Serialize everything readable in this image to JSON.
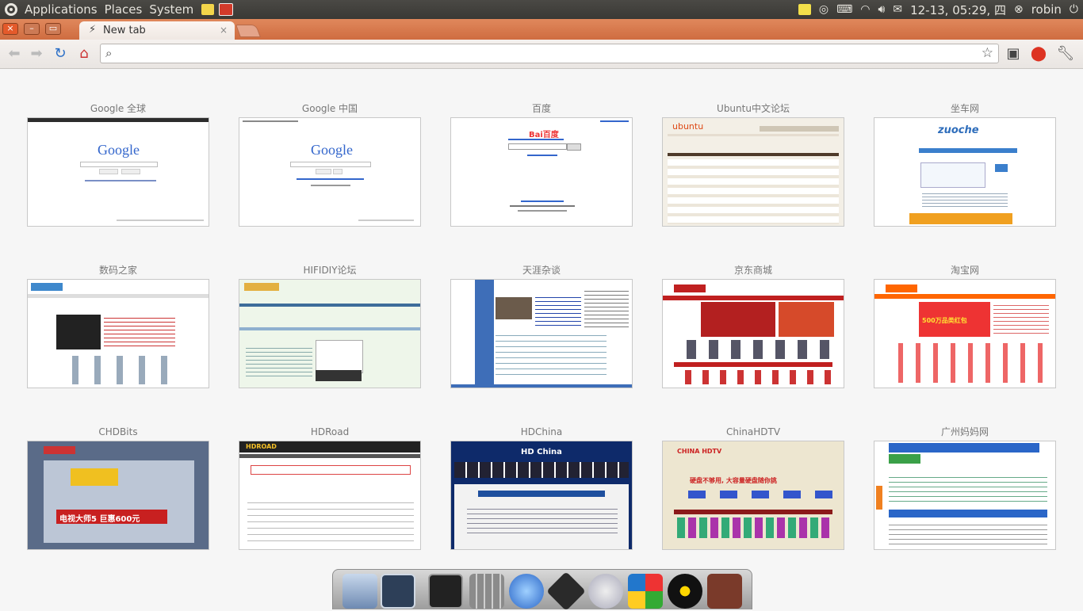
{
  "panel": {
    "menus": [
      "Applications",
      "Places",
      "System"
    ],
    "datetime": "12-13, 05:29, 四",
    "user": "robin"
  },
  "tab": {
    "title": "New tab",
    "close": "×"
  },
  "toolbar": {
    "url": "",
    "placeholder": ""
  },
  "tiles": [
    {
      "title": "Google 全球",
      "thumb_logo": "Google"
    },
    {
      "title": "Google 中国",
      "thumb_logo": "Google"
    },
    {
      "title": "百度",
      "thumb_logo": "Bai百度"
    },
    {
      "title": "Ubuntu中文论坛",
      "thumb_logo": "ubuntu"
    },
    {
      "title": "坐车网",
      "thumb_logo": "zuoche"
    },
    {
      "title": "数码之家",
      "thumb_logo": ""
    },
    {
      "title": "HIFIDIY论坛",
      "thumb_logo": ""
    },
    {
      "title": "天涯杂谈",
      "thumb_logo": ""
    },
    {
      "title": "京东商城",
      "thumb_logo": ""
    },
    {
      "title": "淘宝网",
      "thumb_logo": ""
    },
    {
      "title": "CHDBits",
      "thumb_logo": ""
    },
    {
      "title": "HDRoad",
      "thumb_logo": "HDROAD"
    },
    {
      "title": "HDChina",
      "thumb_logo": "HD China"
    },
    {
      "title": "ChinaHDTV",
      "thumb_logo": "CHINA HDTV"
    },
    {
      "title": "广州妈妈网",
      "thumb_logo": ""
    }
  ],
  "thumb_texts": {
    "chdbits_banner": "电视大师5 巨惠600元",
    "chinahdtv_banner": "硬盘不够用, 大容量硬盘随你挑",
    "taobao_banner": "500万品类红包"
  },
  "colors": {
    "panel_bg": "#3c3b37",
    "tabstrip": "#d8794b",
    "accent": "#dd4814"
  }
}
